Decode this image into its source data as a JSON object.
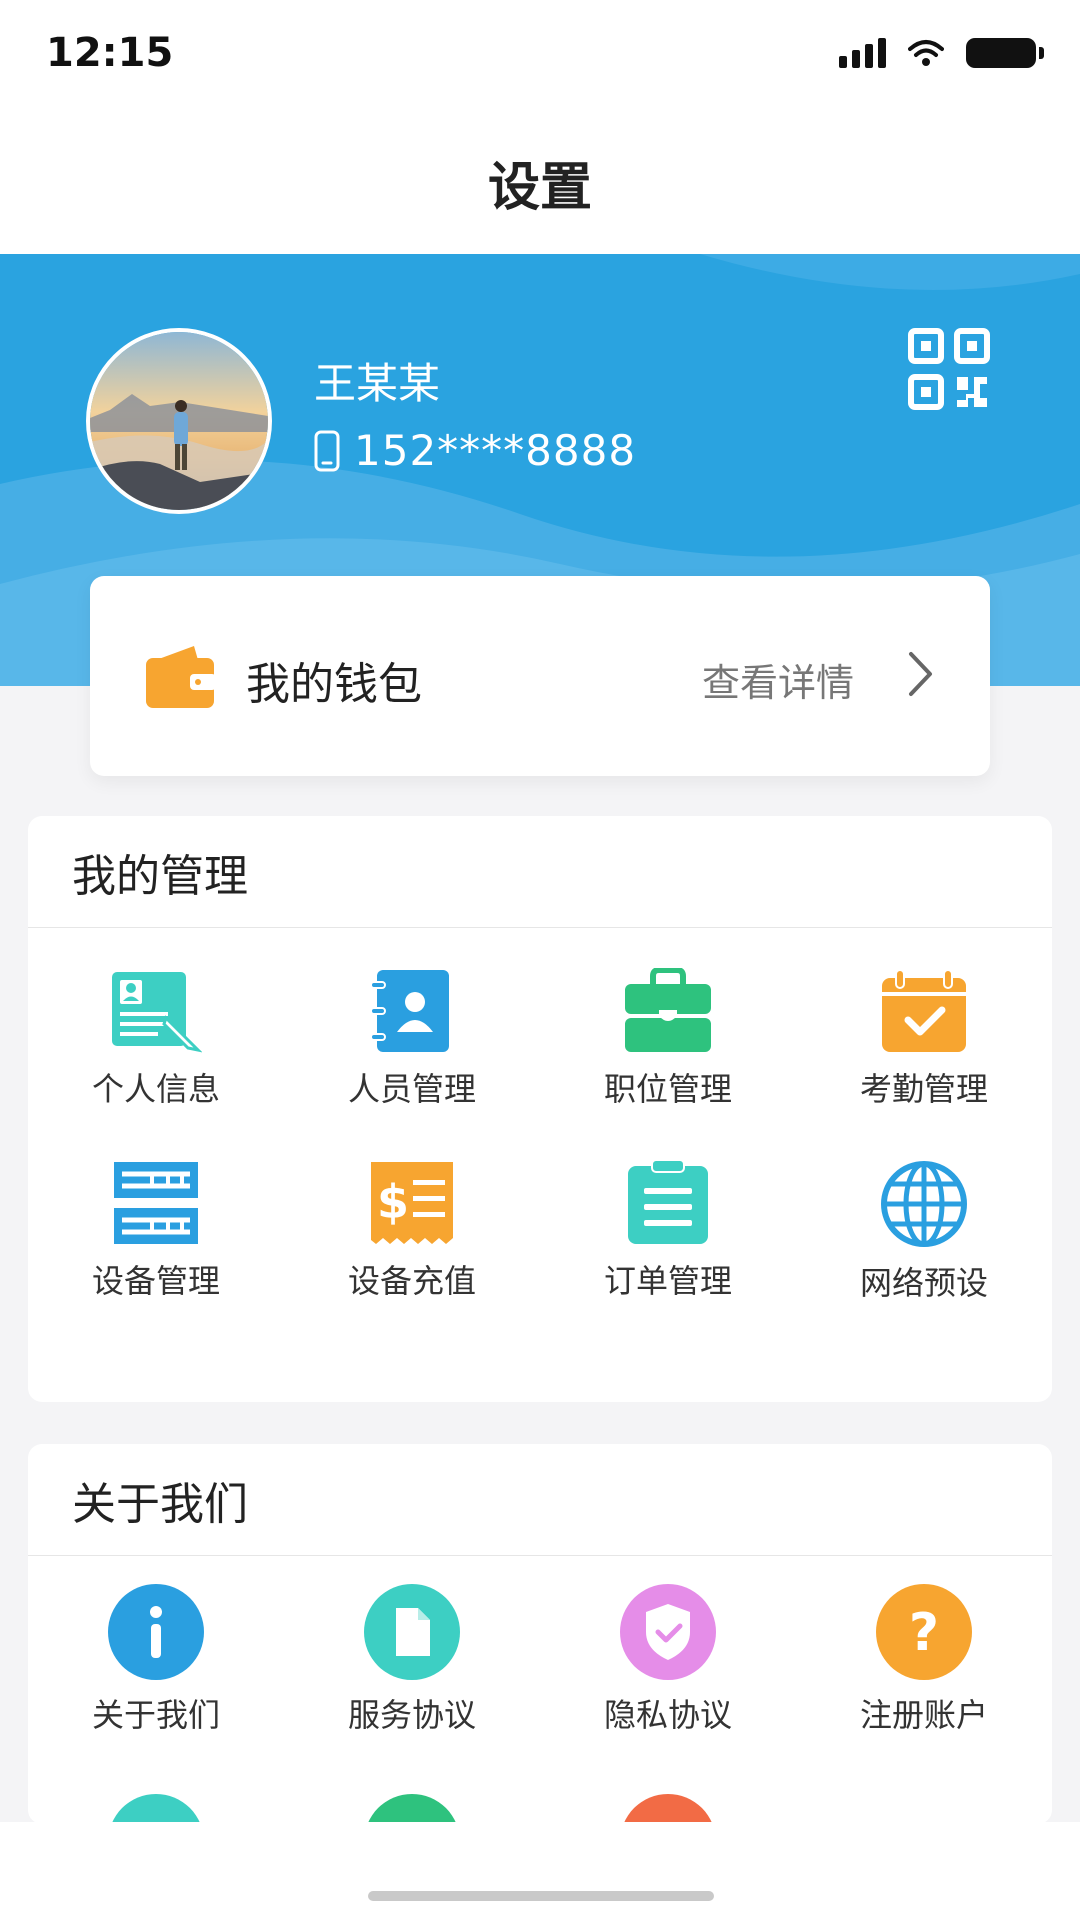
{
  "status_bar": {
    "time": "12:15"
  },
  "nav": {
    "title": "设置"
  },
  "profile": {
    "name": "王某某",
    "phone": "152****8888"
  },
  "wallet": {
    "title": "我的钱包",
    "link": "查看详情"
  },
  "management": {
    "title": "我的管理",
    "items": [
      {
        "label": "个人信息",
        "icon": "profile-card-icon",
        "color": "#3dcfc3"
      },
      {
        "label": "人员管理",
        "icon": "contacts-book-icon",
        "color": "#2a9fe0"
      },
      {
        "label": "职位管理",
        "icon": "briefcase-icon",
        "color": "#2ec27e"
      },
      {
        "label": "考勤管理",
        "icon": "calendar-check-icon",
        "color": "#f7a530"
      },
      {
        "label": "设备管理",
        "icon": "server-rack-icon",
        "color": "#2a9fe0"
      },
      {
        "label": "设备充值",
        "icon": "recharge-receipt-icon",
        "color": "#f7a530"
      },
      {
        "label": "订单管理",
        "icon": "clipboard-icon",
        "color": "#3dcfc3"
      },
      {
        "label": "网络预设",
        "icon": "globe-icon",
        "color": "#2a9fe0"
      }
    ]
  },
  "about": {
    "title": "关于我们",
    "items": [
      {
        "label": "关于我们",
        "icon": "info-icon",
        "color": "#2a9fe0"
      },
      {
        "label": "服务协议",
        "icon": "document-icon",
        "color": "#3dcfc3"
      },
      {
        "label": "隐私协议",
        "icon": "shield-check-icon",
        "color": "#e58de8"
      },
      {
        "label": "注册账户",
        "icon": "question-icon",
        "color": "#f7a530"
      }
    ]
  },
  "colors": {
    "banner_blue": "#2aa3e0",
    "page_bg": "#f4f4f6"
  }
}
